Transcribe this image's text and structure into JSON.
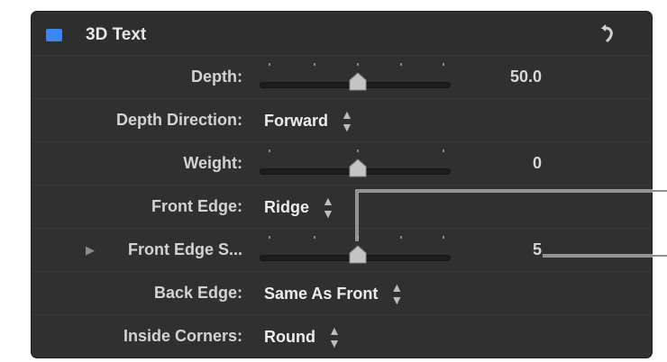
{
  "header": {
    "title": "3D Text",
    "enabled": true,
    "reset_icon": "undo-arrow-icon",
    "accent_color": "#3a86f2"
  },
  "rows": {
    "depth": {
      "label": "Depth:",
      "value": "50.0",
      "slider_fraction": 0.5
    },
    "depth_direction": {
      "label": "Depth Direction:",
      "value": "Forward"
    },
    "weight": {
      "label": "Weight:",
      "value": "0",
      "slider_fraction": 0.5
    },
    "front_edge": {
      "label": "Front Edge:",
      "value": "Ridge"
    },
    "front_edge_size": {
      "label": "Front Edge S...",
      "value": "5",
      "slider_fraction": 0.5
    },
    "back_edge": {
      "label": "Back Edge:",
      "value": "Same As Front"
    },
    "inside_corners": {
      "label": "Inside Corners:",
      "value": "Round"
    }
  },
  "icons": {
    "popup_arrows": "up-down-arrows-icon",
    "disclosure": "disclosure-triangle-icon"
  },
  "glyphs": {
    "popup_arrows": "▲\n▼",
    "disclosure": "▶"
  }
}
